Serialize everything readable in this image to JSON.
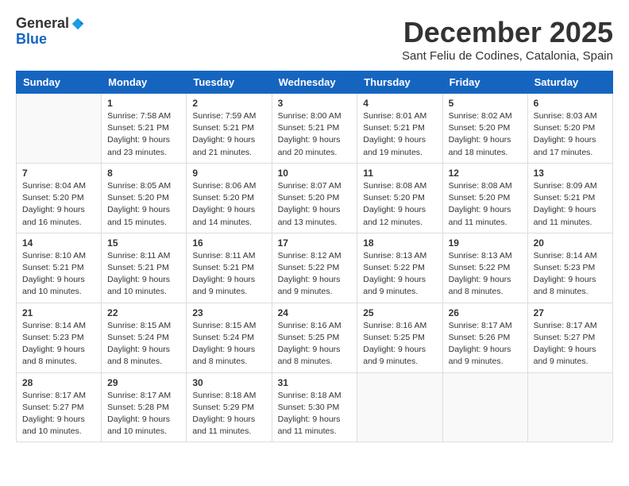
{
  "header": {
    "logo_line1": "General",
    "logo_line2": "Blue",
    "month_title": "December 2025",
    "location": "Sant Feliu de Codines, Catalonia, Spain"
  },
  "weekdays": [
    "Sunday",
    "Monday",
    "Tuesday",
    "Wednesday",
    "Thursday",
    "Friday",
    "Saturday"
  ],
  "weeks": [
    [
      {
        "day": null
      },
      {
        "day": 1,
        "sunrise": "7:58 AM",
        "sunset": "5:21 PM",
        "daylight": "9 hours and 23 minutes."
      },
      {
        "day": 2,
        "sunrise": "7:59 AM",
        "sunset": "5:21 PM",
        "daylight": "9 hours and 21 minutes."
      },
      {
        "day": 3,
        "sunrise": "8:00 AM",
        "sunset": "5:21 PM",
        "daylight": "9 hours and 20 minutes."
      },
      {
        "day": 4,
        "sunrise": "8:01 AM",
        "sunset": "5:21 PM",
        "daylight": "9 hours and 19 minutes."
      },
      {
        "day": 5,
        "sunrise": "8:02 AM",
        "sunset": "5:20 PM",
        "daylight": "9 hours and 18 minutes."
      },
      {
        "day": 6,
        "sunrise": "8:03 AM",
        "sunset": "5:20 PM",
        "daylight": "9 hours and 17 minutes."
      }
    ],
    [
      {
        "day": 7,
        "sunrise": "8:04 AM",
        "sunset": "5:20 PM",
        "daylight": "9 hours and 16 minutes."
      },
      {
        "day": 8,
        "sunrise": "8:05 AM",
        "sunset": "5:20 PM",
        "daylight": "9 hours and 15 minutes."
      },
      {
        "day": 9,
        "sunrise": "8:06 AM",
        "sunset": "5:20 PM",
        "daylight": "9 hours and 14 minutes."
      },
      {
        "day": 10,
        "sunrise": "8:07 AM",
        "sunset": "5:20 PM",
        "daylight": "9 hours and 13 minutes."
      },
      {
        "day": 11,
        "sunrise": "8:08 AM",
        "sunset": "5:20 PM",
        "daylight": "9 hours and 12 minutes."
      },
      {
        "day": 12,
        "sunrise": "8:08 AM",
        "sunset": "5:20 PM",
        "daylight": "9 hours and 11 minutes."
      },
      {
        "day": 13,
        "sunrise": "8:09 AM",
        "sunset": "5:21 PM",
        "daylight": "9 hours and 11 minutes."
      }
    ],
    [
      {
        "day": 14,
        "sunrise": "8:10 AM",
        "sunset": "5:21 PM",
        "daylight": "9 hours and 10 minutes."
      },
      {
        "day": 15,
        "sunrise": "8:11 AM",
        "sunset": "5:21 PM",
        "daylight": "9 hours and 10 minutes."
      },
      {
        "day": 16,
        "sunrise": "8:11 AM",
        "sunset": "5:21 PM",
        "daylight": "9 hours and 9 minutes."
      },
      {
        "day": 17,
        "sunrise": "8:12 AM",
        "sunset": "5:22 PM",
        "daylight": "9 hours and 9 minutes."
      },
      {
        "day": 18,
        "sunrise": "8:13 AM",
        "sunset": "5:22 PM",
        "daylight": "9 hours and 9 minutes."
      },
      {
        "day": 19,
        "sunrise": "8:13 AM",
        "sunset": "5:22 PM",
        "daylight": "9 hours and 8 minutes."
      },
      {
        "day": 20,
        "sunrise": "8:14 AM",
        "sunset": "5:23 PM",
        "daylight": "9 hours and 8 minutes."
      }
    ],
    [
      {
        "day": 21,
        "sunrise": "8:14 AM",
        "sunset": "5:23 PM",
        "daylight": "9 hours and 8 minutes."
      },
      {
        "day": 22,
        "sunrise": "8:15 AM",
        "sunset": "5:24 PM",
        "daylight": "9 hours and 8 minutes."
      },
      {
        "day": 23,
        "sunrise": "8:15 AM",
        "sunset": "5:24 PM",
        "daylight": "9 hours and 8 minutes."
      },
      {
        "day": 24,
        "sunrise": "8:16 AM",
        "sunset": "5:25 PM",
        "daylight": "9 hours and 8 minutes."
      },
      {
        "day": 25,
        "sunrise": "8:16 AM",
        "sunset": "5:25 PM",
        "daylight": "9 hours and 9 minutes."
      },
      {
        "day": 26,
        "sunrise": "8:17 AM",
        "sunset": "5:26 PM",
        "daylight": "9 hours and 9 minutes."
      },
      {
        "day": 27,
        "sunrise": "8:17 AM",
        "sunset": "5:27 PM",
        "daylight": "9 hours and 9 minutes."
      }
    ],
    [
      {
        "day": 28,
        "sunrise": "8:17 AM",
        "sunset": "5:27 PM",
        "daylight": "9 hours and 10 minutes."
      },
      {
        "day": 29,
        "sunrise": "8:17 AM",
        "sunset": "5:28 PM",
        "daylight": "9 hours and 10 minutes."
      },
      {
        "day": 30,
        "sunrise": "8:18 AM",
        "sunset": "5:29 PM",
        "daylight": "9 hours and 11 minutes."
      },
      {
        "day": 31,
        "sunrise": "8:18 AM",
        "sunset": "5:30 PM",
        "daylight": "9 hours and 11 minutes."
      },
      {
        "day": null
      },
      {
        "day": null
      },
      {
        "day": null
      }
    ]
  ]
}
